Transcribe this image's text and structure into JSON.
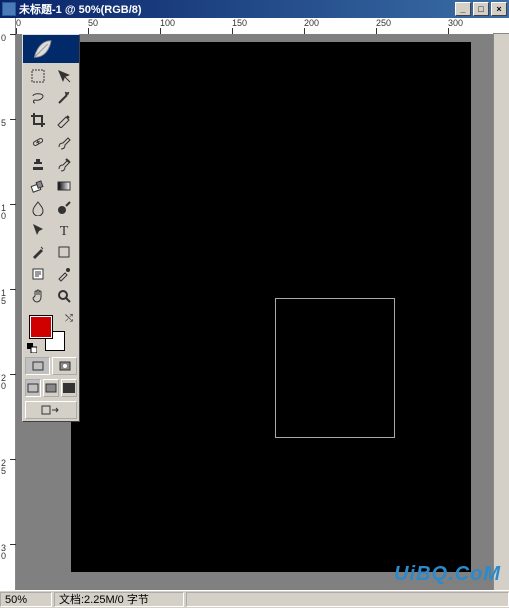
{
  "window": {
    "title": "未标题-1 @ 50%(RGB/8)",
    "min": "_",
    "max": "□",
    "close": "×"
  },
  "ruler_h": [
    "0",
    "50",
    "100",
    "150",
    "200",
    "250",
    "300"
  ],
  "ruler_v": [
    "0",
    "5",
    "10",
    "15",
    "20",
    "25",
    "30"
  ],
  "status": {
    "zoom": "50%",
    "doc": "文档:2.25M/0 字节"
  },
  "colors": {
    "foreground": "#d00000",
    "background": "#ffffff"
  },
  "tools": [
    {
      "name": "marquee-tool",
      "icon": "marquee"
    },
    {
      "name": "move-tool",
      "icon": "move"
    },
    {
      "name": "lasso-tool",
      "icon": "lasso"
    },
    {
      "name": "magic-wand-tool",
      "icon": "wand"
    },
    {
      "name": "crop-tool",
      "icon": "crop"
    },
    {
      "name": "slice-tool",
      "icon": "slice"
    },
    {
      "name": "heal-tool",
      "icon": "heal"
    },
    {
      "name": "brush-tool",
      "icon": "brush"
    },
    {
      "name": "stamp-tool",
      "icon": "stamp"
    },
    {
      "name": "history-brush-tool",
      "icon": "histbrush"
    },
    {
      "name": "eraser-tool",
      "icon": "eraser"
    },
    {
      "name": "gradient-tool",
      "icon": "gradient"
    },
    {
      "name": "blur-tool",
      "icon": "blur"
    },
    {
      "name": "dodge-tool",
      "icon": "dodge"
    },
    {
      "name": "path-select-tool",
      "icon": "pathsel"
    },
    {
      "name": "type-tool",
      "icon": "type"
    },
    {
      "name": "pen-tool",
      "icon": "pen"
    },
    {
      "name": "shape-tool",
      "icon": "shape"
    },
    {
      "name": "notes-tool",
      "icon": "notes"
    },
    {
      "name": "eyedropper-tool",
      "icon": "eyedrop"
    },
    {
      "name": "hand-tool",
      "icon": "hand"
    },
    {
      "name": "zoom-tool",
      "icon": "zoom"
    }
  ],
  "watermark": "UiBQ.CoM"
}
